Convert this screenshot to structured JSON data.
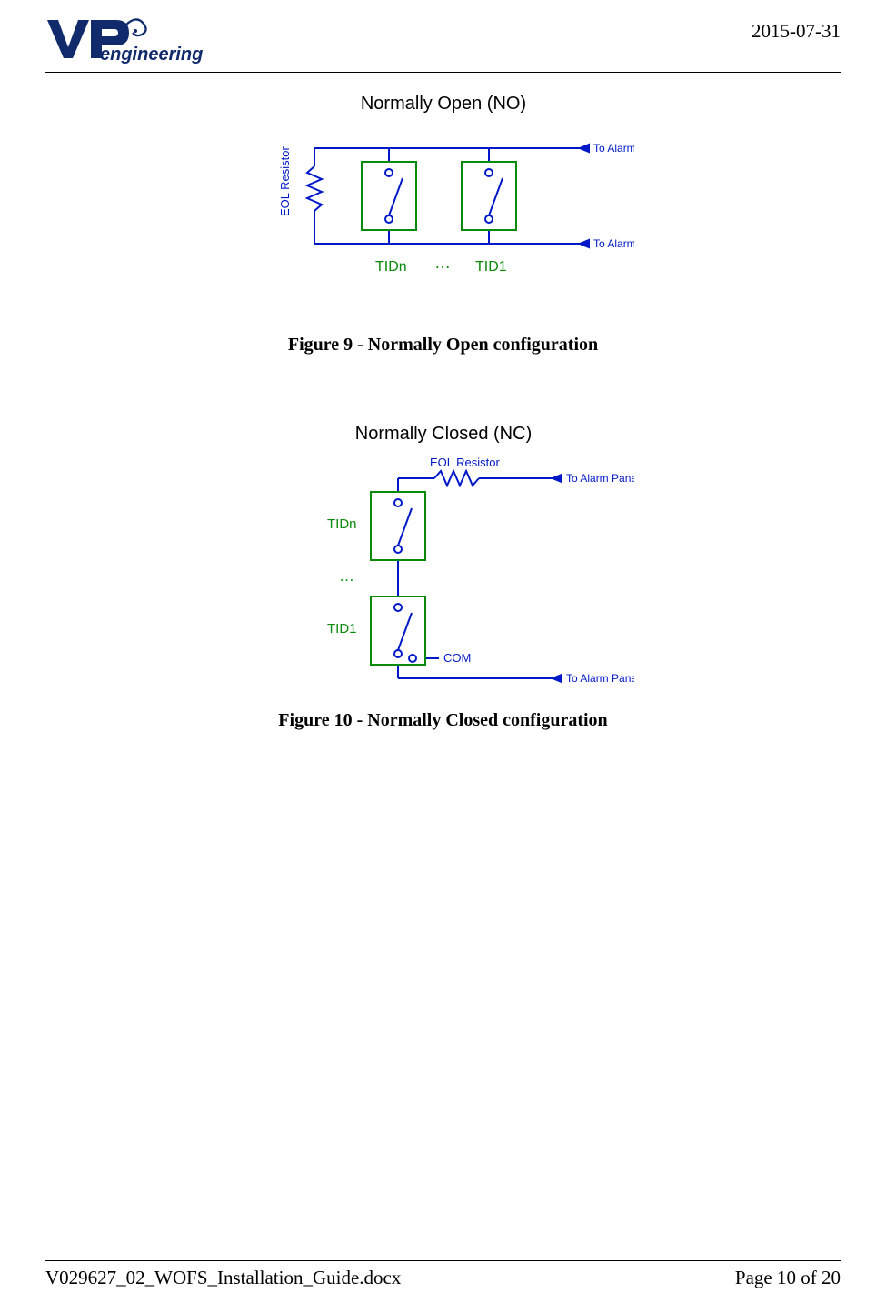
{
  "header": {
    "logo_text_main": "VP",
    "logo_text_sub": "engineering",
    "date": "2015-07-31"
  },
  "figure9": {
    "title": "Normally Open (NO)",
    "eol_resistor": "EOL Resistor",
    "to_alarm_top": "To Alarm Panel",
    "to_alarm_bottom": "To Alarm Panel",
    "tidn": "TIDn",
    "dots": "…",
    "tid1": "TID1",
    "caption": "Figure 9 - Normally Open configuration"
  },
  "figure10": {
    "title": "Normally Closed (NC)",
    "eol_resistor": "EOL Resistor",
    "to_alarm_top": "To Alarm Panel",
    "to_alarm_bottom": "To Alarm Panel",
    "tidn": "TIDn",
    "dots": "…",
    "tid1": "TID1",
    "com": "COM",
    "caption": "Figure 10 - Normally Closed configuration"
  },
  "footer": {
    "filename": "V029627_02_WOFS_Installation_Guide.docx",
    "page": "Page 10 of 20"
  }
}
